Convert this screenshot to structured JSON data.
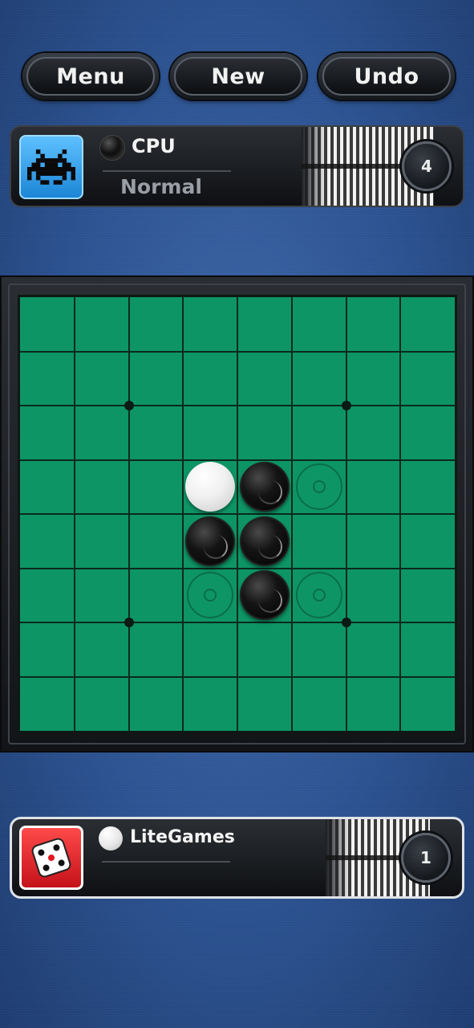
{
  "toolbar": {
    "menu_label": "Menu",
    "new_label": "New",
    "undo_label": "Undo"
  },
  "opponent": {
    "name": "CPU",
    "level": "Normal",
    "disc_color": "black",
    "score": "4",
    "avatar_icon": "space-invader-icon",
    "avatar_color": "#2a9bea"
  },
  "player": {
    "name": "LiteGames",
    "disc_color": "white",
    "score": "1",
    "avatar_icon": "dice-icon",
    "avatar_color": "#e0161f"
  },
  "board": {
    "size": 8,
    "color": "#0e9566",
    "discs": [
      {
        "row": 3,
        "col": 3,
        "color": "white"
      },
      {
        "row": 3,
        "col": 4,
        "color": "black"
      },
      {
        "row": 4,
        "col": 3,
        "color": "black"
      },
      {
        "row": 4,
        "col": 4,
        "color": "black"
      },
      {
        "row": 5,
        "col": 4,
        "color": "black"
      }
    ],
    "valid_moves": [
      {
        "row": 3,
        "col": 5
      },
      {
        "row": 5,
        "col": 3
      },
      {
        "row": 5,
        "col": 5
      }
    ],
    "star_points": [
      {
        "row": 2,
        "col": 2
      },
      {
        "row": 2,
        "col": 6
      },
      {
        "row": 6,
        "col": 2
      },
      {
        "row": 6,
        "col": 6
      }
    ]
  }
}
